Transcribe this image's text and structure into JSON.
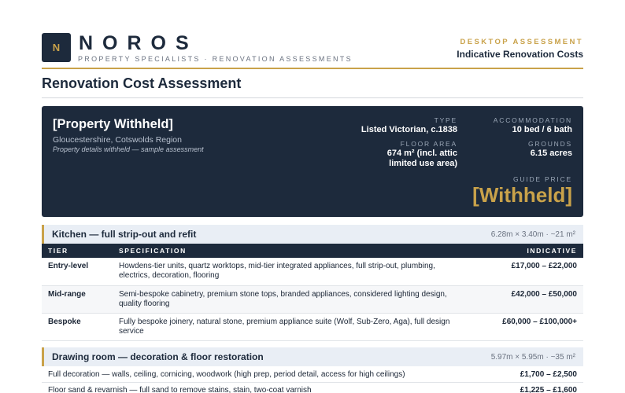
{
  "header": {
    "logo_letter": "N",
    "brand": "NOROS",
    "tagline": "PROPERTY SPECIALISTS · RENOVATION ASSESSMENTS",
    "kicker": "DESKTOP ASSESSMENT",
    "subtitle": "Indicative Renovation Costs"
  },
  "doc_title": "Renovation Cost Assessment",
  "property": {
    "name": "[Property Withheld]",
    "location": "Gloucestershire, Cotswolds Region",
    "note": "Property details withheld — sample assessment",
    "type_label": "TYPE",
    "type_value": "Listed Victorian, c.1838",
    "accommodation_label": "ACCOMMODATION",
    "accommodation_value": "10 bed / 6 bath",
    "floor_area_label": "FLOOR AREA",
    "floor_area_value_1": "674 m² (incl. attic",
    "floor_area_value_2": "limited use area)",
    "grounds_label": "GROUNDS",
    "grounds_value": "6.15 acres",
    "guide_label": "GUIDE PRICE",
    "guide_value": "[Withheld]"
  },
  "kitchen": {
    "title": "Kitchen — full strip-out and refit",
    "dims": "6.28m × 3.40m · ~21 m²",
    "columns": [
      "TIER",
      "SPECIFICATION",
      "INDICATIVE"
    ],
    "rows": [
      {
        "tier": "Entry-level",
        "spec": "Howdens-tier units, quartz worktops, mid-tier integrated appliances, full strip-out, plumbing, electrics, decoration, flooring",
        "cost": "£17,000 – £22,000"
      },
      {
        "tier": "Mid-range",
        "spec": "Semi-bespoke cabinetry, premium stone tops, branded appliances, considered lighting design, quality flooring",
        "cost": "£42,000 – £50,000"
      },
      {
        "tier": "Bespoke",
        "spec": "Fully bespoke joinery, natural stone, premium appliance suite (Wolf, Sub-Zero, Aga), full design service",
        "cost": "£60,000 – £100,000+"
      }
    ]
  },
  "drawing_room": {
    "title": "Drawing room — decoration & floor restoration",
    "dims": "5.97m × 5.95m · ~35 m²",
    "lines": [
      {
        "desc": "Full decoration — walls, ceiling, cornicing, woodwork (high prep, period detail, access for high ceilings)",
        "cost": "£1,700 – £2,500"
      },
      {
        "desc": "Floor sand & revarnish — full sand to remove stains, stain, two-coat varnish",
        "cost": "£1,225 – £1,600"
      }
    ]
  },
  "colors": {
    "navy": "#1d2a3c",
    "gold": "#c9a24a",
    "section_bg": "#e9eef5"
  }
}
